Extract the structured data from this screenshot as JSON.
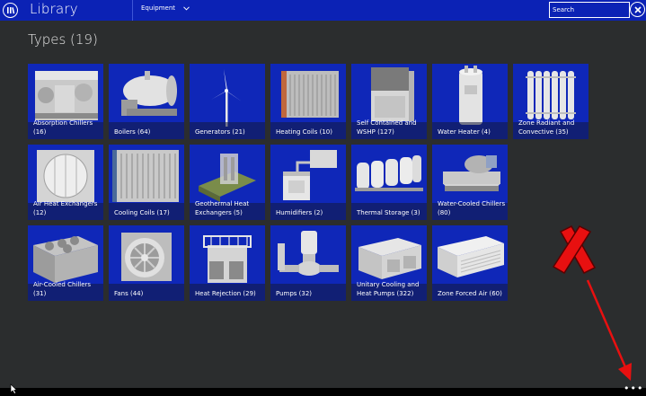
{
  "app": {
    "title": "Library",
    "nav_dropdown_label": "Equipment",
    "search_placeholder": "Search"
  },
  "section": {
    "title": "Types (19)"
  },
  "tiles": [
    {
      "label": "Absorption Chillers (16)",
      "icon": "absorption-chiller"
    },
    {
      "label": "Boilers (64)",
      "icon": "boiler"
    },
    {
      "label": "Generators (21)",
      "icon": "wind-turbine"
    },
    {
      "label": "Heating Coils (10)",
      "icon": "heating-coil"
    },
    {
      "label": "Self Contained and WSHP (127)",
      "icon": "self-contained-unit"
    },
    {
      "label": "Water Heater (4)",
      "icon": "water-heater"
    },
    {
      "label": "Zone Radiant and Convective (35)",
      "icon": "radiator"
    },
    {
      "label": "Air Heat Exchangers (12)",
      "icon": "air-heat-exchanger"
    },
    {
      "label": "Cooling Coils (17)",
      "icon": "cooling-coil"
    },
    {
      "label": "Geothermal Heat Exchangers (5)",
      "icon": "geothermal-exchanger"
    },
    {
      "label": "Humidifiers (2)",
      "icon": "humidifier"
    },
    {
      "label": "Thermal Storage (3)",
      "icon": "thermal-storage"
    },
    {
      "label": "Water-Cooled Chillers (80)",
      "icon": "water-cooled-chiller"
    },
    {
      "label": "Air-Cooled Chillers (31)",
      "icon": "air-cooled-chiller"
    },
    {
      "label": "Fans (44)",
      "icon": "fan"
    },
    {
      "label": "Heat Rejection (29)",
      "icon": "cooling-tower"
    },
    {
      "label": "Pumps (32)",
      "icon": "pump"
    },
    {
      "label": "Unitary Cooling and Heat Pumps (322)",
      "icon": "rooftop-unit"
    },
    {
      "label": "Zone Forced Air (60)",
      "icon": "ptac-unit"
    }
  ],
  "colors": {
    "topbar": "#0b22b5",
    "tile": "#0f27b8",
    "background": "#2b2d2e",
    "annotation": "#e81010"
  },
  "footer": {
    "more_icon": "more-dots-icon"
  }
}
